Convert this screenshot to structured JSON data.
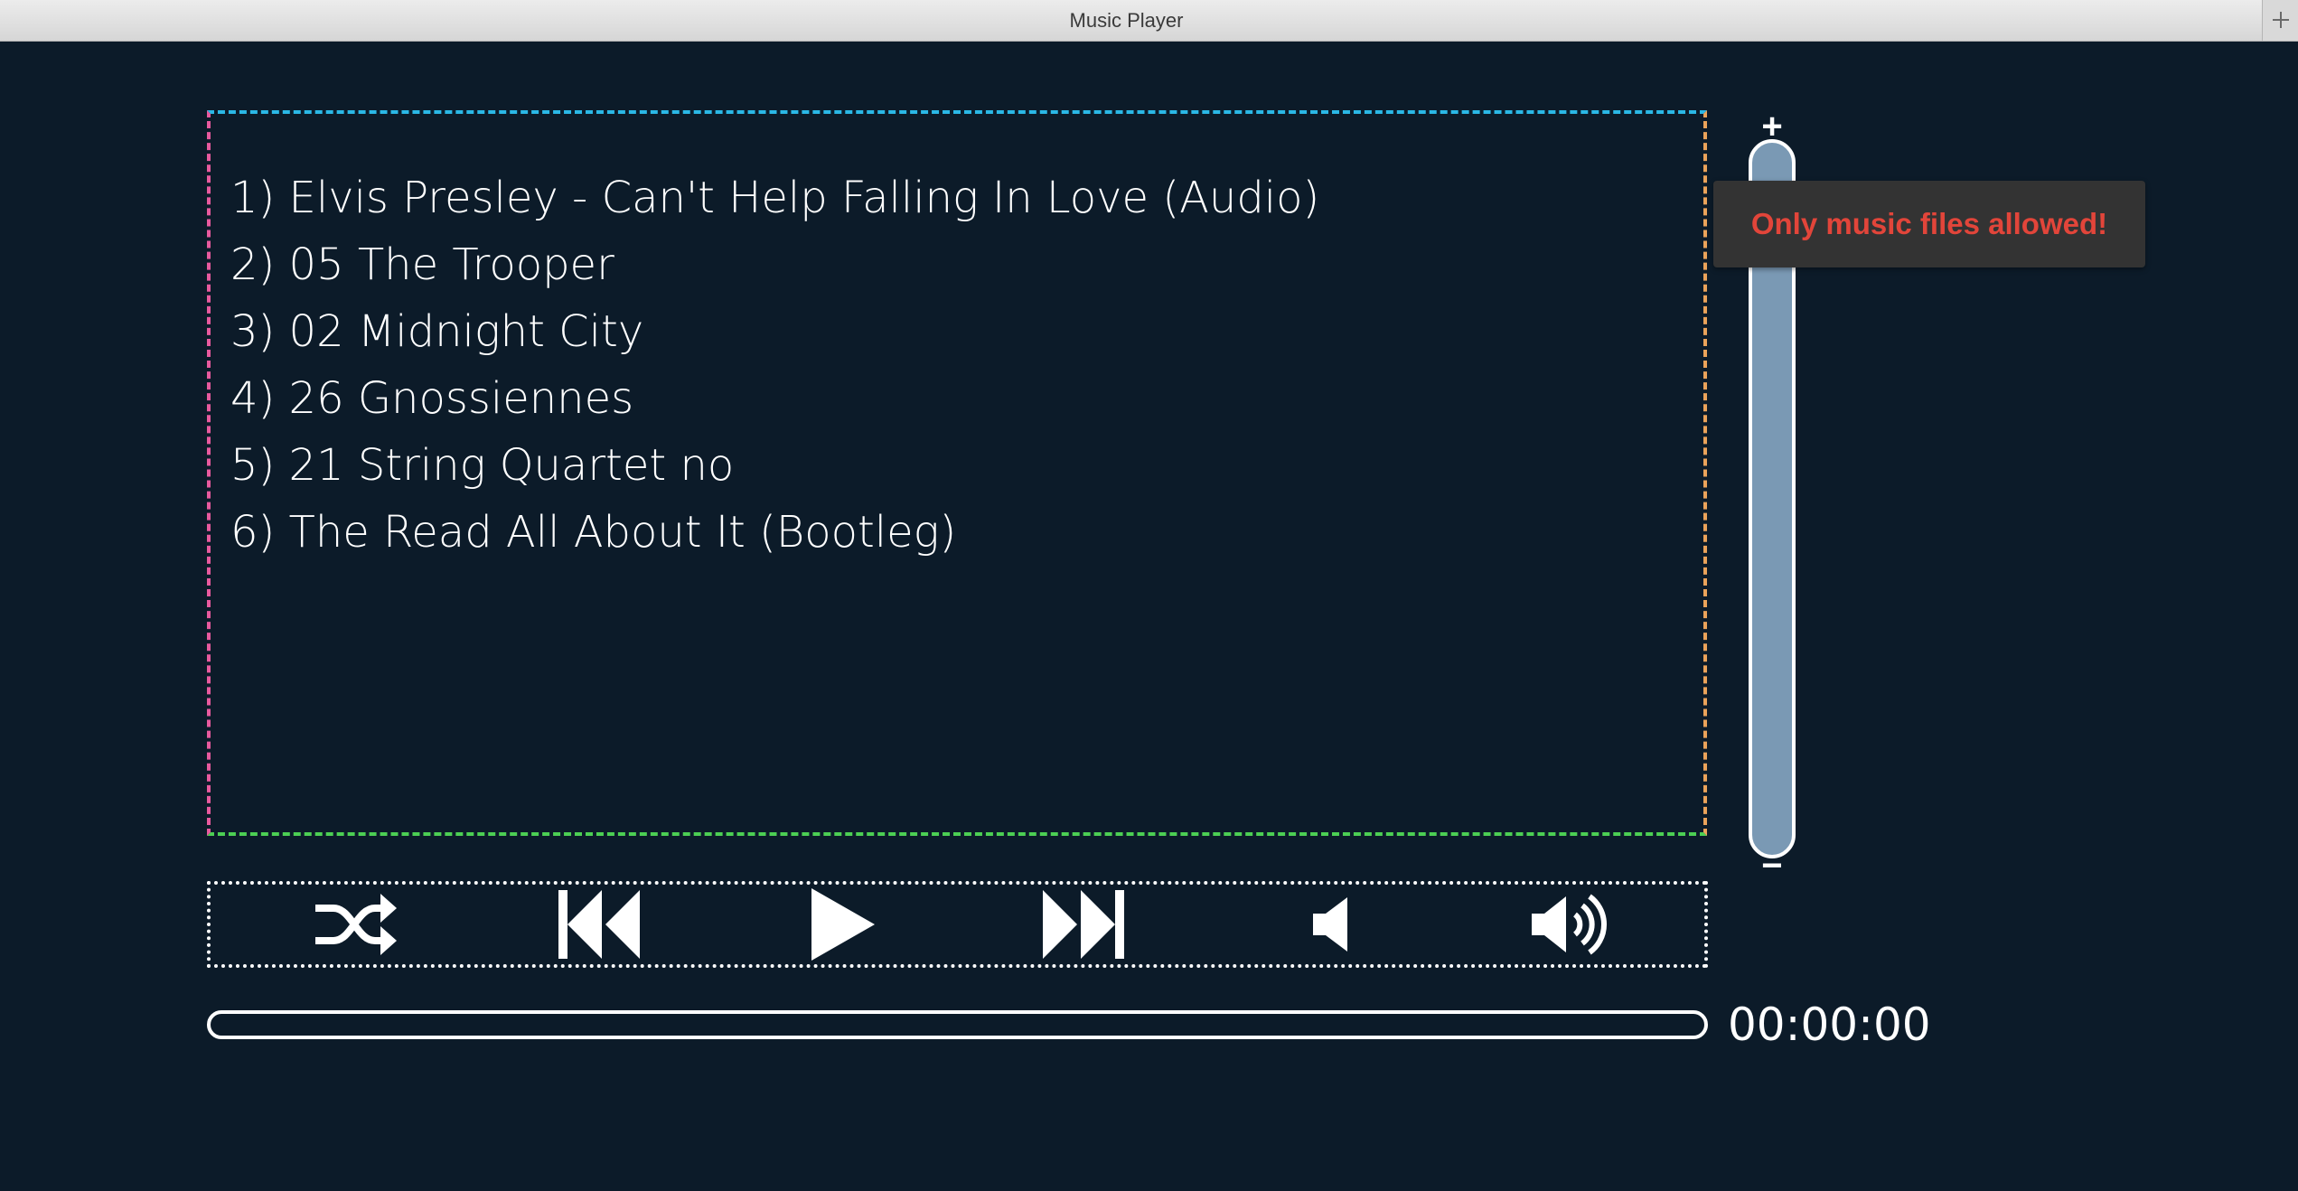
{
  "window": {
    "title": "Music Player"
  },
  "playlist": {
    "items": [
      "1) Elvis Presley - Can't Help Falling In Love (Audio)",
      "2) 05 The Trooper",
      "3) 02 Midnight City",
      "4) 26 Gnossiennes",
      "5) 21 String Quartet no",
      "6) The Read All About It (Bootleg)"
    ]
  },
  "volume": {
    "plus_label": "+",
    "minus_label": "−",
    "level": 1.0
  },
  "toast": {
    "message": "Only music files allowed!"
  },
  "controls": {
    "icons": [
      "shuffle-icon",
      "previous-icon",
      "play-icon",
      "next-icon",
      "volume-down-icon",
      "volume-up-icon"
    ]
  },
  "progress": {
    "fraction": 0,
    "time": "00:00:00"
  },
  "colors": {
    "background": "#0c1b29",
    "volume_fill": "#7a99b4",
    "toast_text": "#e2453a",
    "toast_bg": "#333333",
    "border_top": "#2bb8e6",
    "border_left": "#e85a9e",
    "border_right": "#eba35a",
    "border_bottom": "#4ccf53"
  }
}
